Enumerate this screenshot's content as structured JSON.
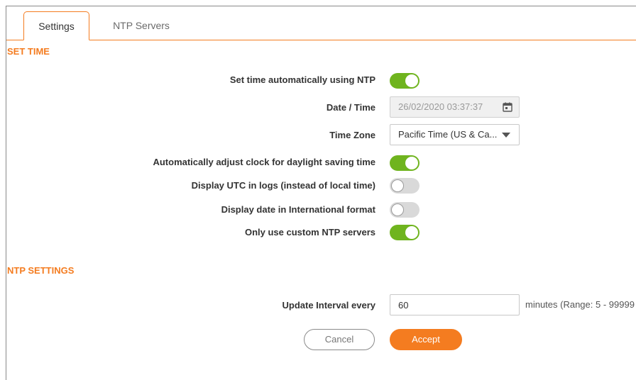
{
  "tabs": [
    {
      "label": "Settings",
      "active": true
    },
    {
      "label": "NTP Servers",
      "active": false
    }
  ],
  "set_time": {
    "header": "SET TIME",
    "auto_ntp": {
      "label": "Set time automatically using NTP",
      "enabled": true
    },
    "datetime": {
      "label": "Date / Time",
      "value": "26/02/2020 03:37:37",
      "icon": "calendar-icon"
    },
    "timezone": {
      "label": "Time Zone",
      "value": "Pacific Time (US & Ca...",
      "icon": "chevron-down-icon"
    },
    "dst": {
      "label": "Automatically adjust clock for daylight saving time",
      "enabled": true
    },
    "utc_logs": {
      "label": "Display UTC in logs (instead of local time)",
      "enabled": false
    },
    "intl_date": {
      "label": "Display date in International format",
      "enabled": false
    },
    "custom_ntp": {
      "label": "Only use custom NTP servers",
      "enabled": true
    }
  },
  "ntp_settings": {
    "header": "NTP SETTINGS",
    "update_interval": {
      "label": "Update Interval every",
      "value": "60",
      "hint": "minutes (Range: 5 - 99999"
    }
  },
  "buttons": {
    "cancel": "Cancel",
    "accept": "Accept"
  },
  "colors": {
    "accent": "#f47c20",
    "toggle_on": "#6fb41e",
    "toggle_off": "#d9d9d9"
  }
}
